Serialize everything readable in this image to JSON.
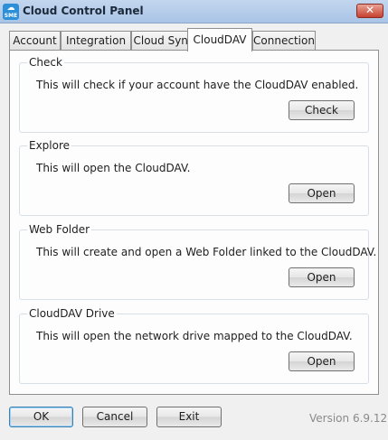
{
  "window": {
    "title": "Cloud Control Panel",
    "icon_text": "SME",
    "close_glyph": "✕"
  },
  "tabs": [
    {
      "label": "Account"
    },
    {
      "label": "Integration"
    },
    {
      "label": "Cloud Sync"
    },
    {
      "label": "CloudDAV",
      "active": true
    },
    {
      "label": "Connection"
    }
  ],
  "groups": {
    "check": {
      "title": "Check",
      "description": "This will check if your account have the CloudDAV enabled.",
      "button": "Check"
    },
    "explore": {
      "title": "Explore",
      "description": "This will open the CloudDAV.",
      "button": "Open"
    },
    "web_folder": {
      "title": "Web Folder",
      "description": "This will create and open a Web Folder linked to the CloudDAV.",
      "button": "Open"
    },
    "drive": {
      "title": "CloudDAV Drive",
      "description": "This will open the network drive mapped to the CloudDAV.",
      "button": "Open"
    }
  },
  "footer": {
    "ok": "OK",
    "cancel": "Cancel",
    "exit": "Exit",
    "version": "Version 6.9.12"
  }
}
